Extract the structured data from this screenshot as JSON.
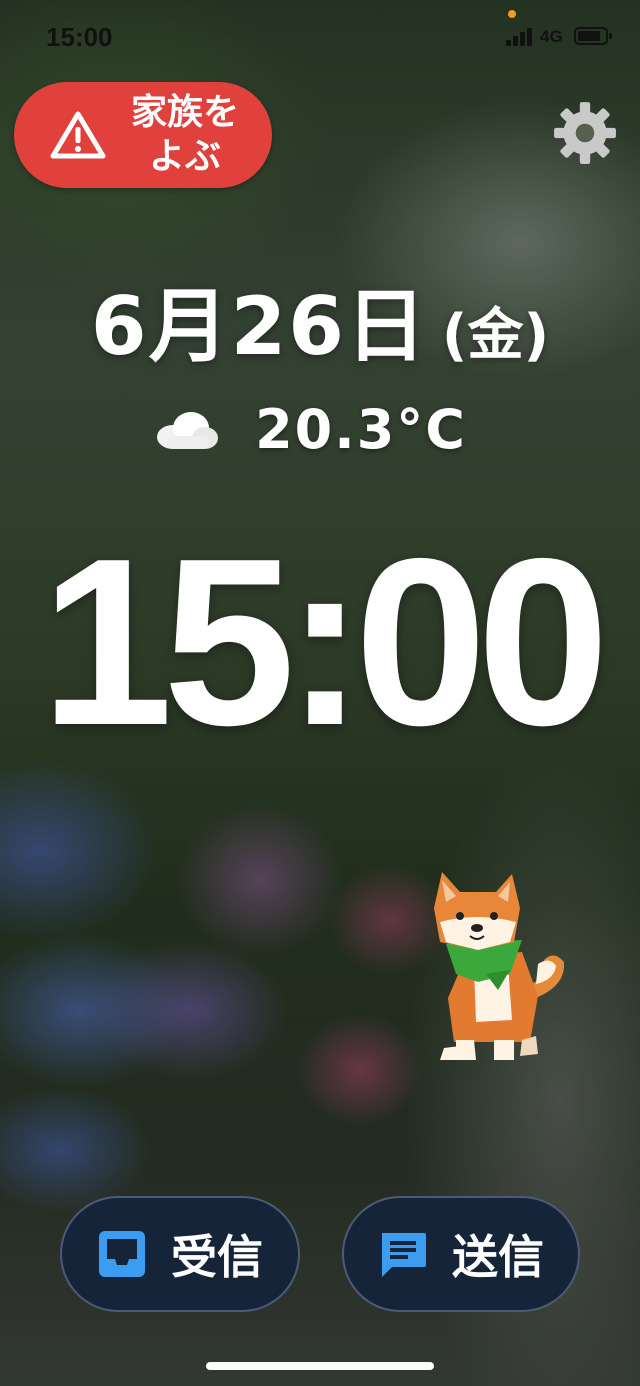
{
  "status_bar": {
    "time": "15:00",
    "network": "4G",
    "signal_bars": 4,
    "battery_level": 0.8
  },
  "family_call": {
    "label": "家族を\nよぶ",
    "icon": "warning-triangle-icon",
    "color": "#e0413c"
  },
  "settings": {
    "icon": "gear-icon"
  },
  "date": {
    "main": "6月26日",
    "weekday": "(金)"
  },
  "weather": {
    "icon": "cloud-icon",
    "temperature": "20.3°C"
  },
  "clock": {
    "time": "15:00"
  },
  "mascot": {
    "icon": "shiba-dog-icon"
  },
  "actions": {
    "inbox": {
      "label": "受信",
      "icon": "inbox-icon",
      "icon_color": "#3b9cf0"
    },
    "send": {
      "label": "送信",
      "icon": "message-icon",
      "icon_color": "#3b9cf0"
    }
  }
}
